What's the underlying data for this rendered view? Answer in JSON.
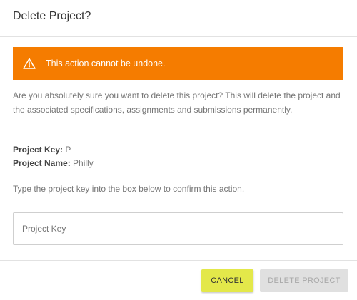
{
  "dialog": {
    "title": "Delete Project?"
  },
  "warning": {
    "icon": "warning-triangle-icon",
    "text": "This action cannot be undone.",
    "color": "#f57c00"
  },
  "description": "Are you absolutely sure you want to delete this project? This will delete the project and the associated specifications, assignments and submissions permanently.",
  "project": {
    "key_label": "Project Key:",
    "key_value": "P",
    "name_label": "Project Name:",
    "name_value": "Philly"
  },
  "instruction": "Type the project key into the box below to confirm this action.",
  "input": {
    "placeholder": "Project Key",
    "value": ""
  },
  "buttons": {
    "cancel_label": "CANCEL",
    "cancel_color": "#e3e84a",
    "delete_label": "DELETE PROJECT",
    "delete_enabled": false
  }
}
